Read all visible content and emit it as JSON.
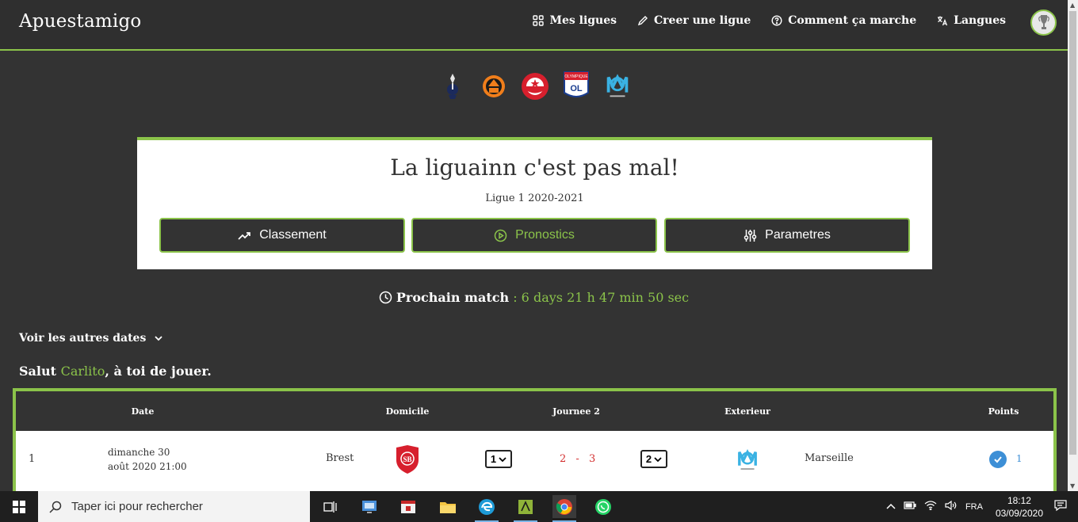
{
  "app": {
    "brand": "Apuestamigo",
    "nav": [
      {
        "label": "Mes ligues",
        "icon": "grid-icon"
      },
      {
        "label": "Creer une ligue",
        "icon": "pencil-icon"
      },
      {
        "label": "Comment ça marche",
        "icon": "help-circle-icon"
      },
      {
        "label": "Langues",
        "icon": "translate-icon"
      }
    ]
  },
  "league": {
    "title": "La liguainn c'est pas mal!",
    "subtitle": "Ligue 1 2020-2021",
    "buttons": [
      {
        "label": "Classement",
        "icon": "trending-icon"
      },
      {
        "label": "Pronostics",
        "icon": "play-circle-icon",
        "active": true
      },
      {
        "label": "Parametres",
        "icon": "sliders-icon"
      }
    ]
  },
  "countdown": {
    "label": "Prochain match",
    "value": ": 6 days 21 h 47 min 50 sec"
  },
  "other_dates": "Voir les autres dates",
  "greeting": {
    "prefix": "Salut ",
    "user": "Carlito",
    "suffix": ", à toi de jouer."
  },
  "table": {
    "headers": [
      "Date",
      "Domicile",
      "Journee 2",
      "Exterieur",
      "Points"
    ],
    "rows": [
      {
        "index": "1",
        "date_line1": "dimanche 30",
        "date_line2": "août 2020 21:00",
        "home": "Brest",
        "home_pick": "1",
        "score_home": "2",
        "score_sep": "-",
        "score_away": "3",
        "away_pick": "2",
        "away": "Marseille",
        "points": "1"
      }
    ]
  },
  "taskbar": {
    "search_placeholder": "Taper ici pour rechercher",
    "lang": "FRA",
    "time": "18:12",
    "date": "03/09/2020"
  },
  "colors": {
    "accent": "#8bc34a",
    "background": "#333333",
    "score": "#d32f2f",
    "points": "#3d8fd6"
  }
}
